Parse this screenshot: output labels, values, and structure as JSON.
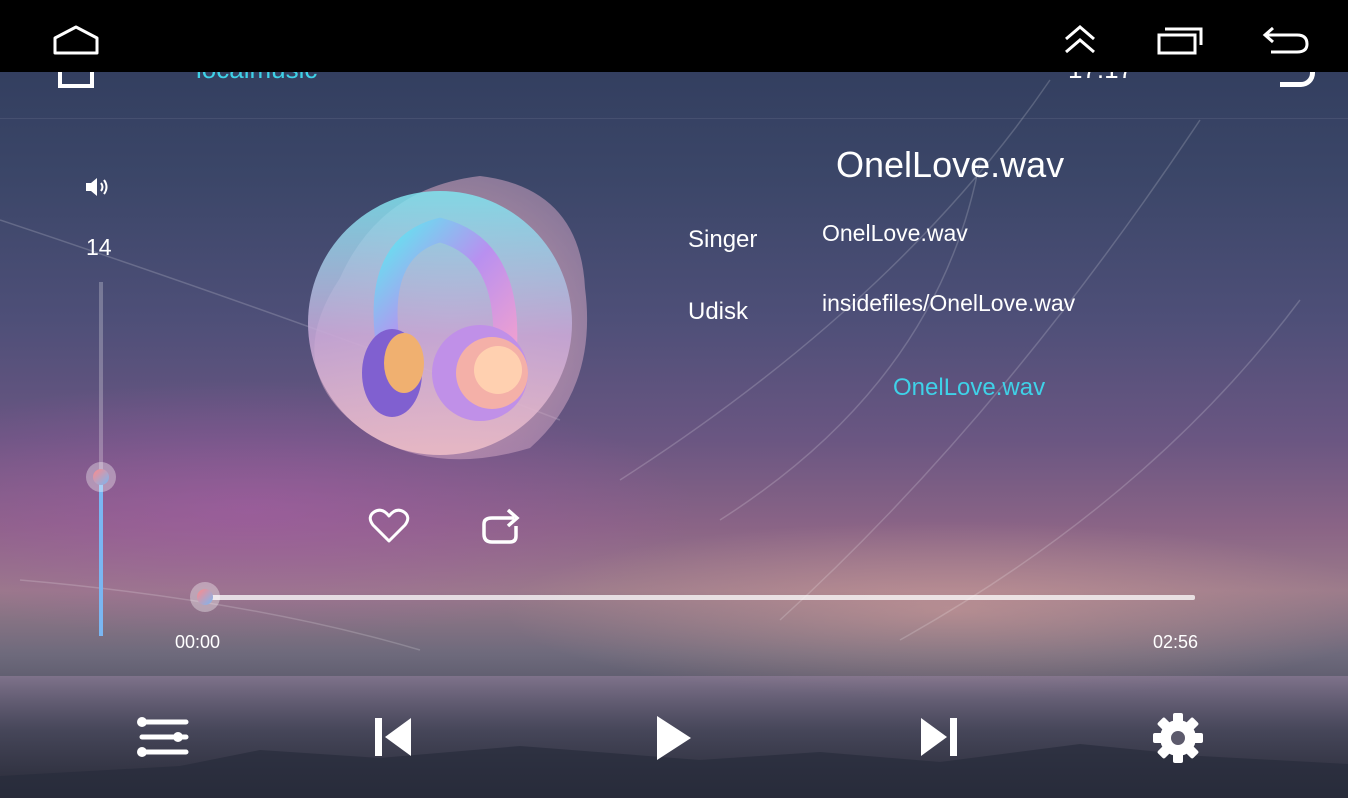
{
  "system_bar": {
    "home_icon": "home-outline-icon",
    "buttons": [
      "chevron-up-double-icon",
      "recent-apps-icon",
      "back-arrow-icon"
    ]
  },
  "header": {
    "title": "localmusic",
    "time": "17:17"
  },
  "volume": {
    "icon": "speaker-icon",
    "value": "14",
    "level": 0.45
  },
  "track": {
    "title": "OnelLove.wav",
    "singer_label": "Singer",
    "singer_value": "OnelLove.wav",
    "source_label": "Udisk",
    "source_value": "insidefiles/OnelLove.wav",
    "lyric": "OnelLove.wav"
  },
  "actions": {
    "favorite_icon": "heart-icon",
    "repeat_icon": "repeat-icon"
  },
  "progress": {
    "current": "00:00",
    "total": "02:56",
    "fraction": 0
  },
  "controls": [
    "playlist-icon",
    "previous-icon",
    "play-icon",
    "next-icon",
    "settings-gear-icon"
  ],
  "colors": {
    "accent": "#3fd2e8",
    "slider": "#7ab6f2"
  }
}
